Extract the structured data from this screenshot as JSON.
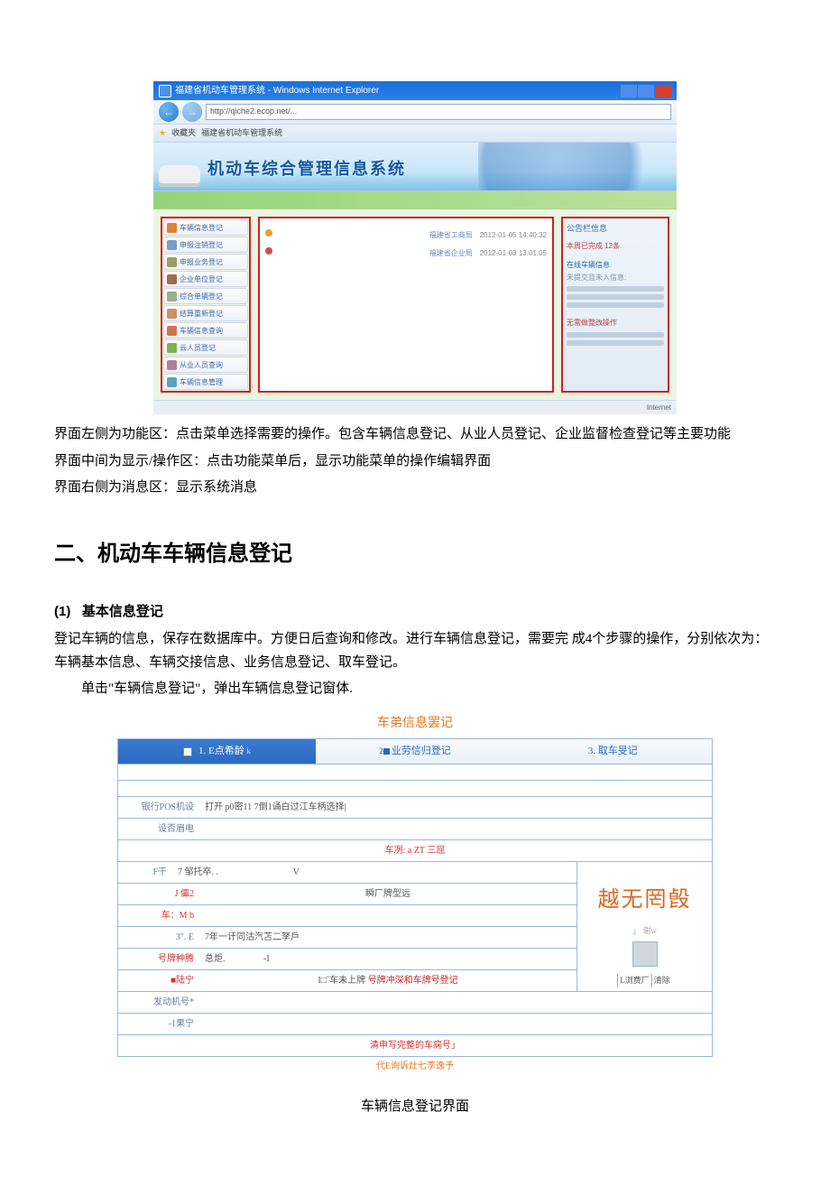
{
  "screenshot1": {
    "win_title": "福建省机动车管理系统 - Windows Internet Explorer",
    "url": "http://qiche2.ecop.net/...",
    "fav_label": "收藏夹",
    "site_label": "福建省机动车管理系统",
    "banner_title": "机动车综合管理信息系统",
    "sidebar_items": [
      "车辆信息登记",
      "申报注销登记",
      "申报业务登记",
      "企业单位登记",
      "综合单辆登记",
      "结算重新登记",
      "车辆信息查询",
      "云人员登记",
      "从业人员查询",
      "车辆信息管理"
    ],
    "center_items": [
      {
        "label_left": "",
        "label_mid": "福建省工商局",
        "date": "2012-01-05 14:40:32"
      },
      {
        "label_left": "",
        "label_mid": "福建省企业局",
        "date": "2012-01-03 13:01:05"
      }
    ],
    "right_title": "公告栏信息",
    "right_red1": "本周已完成 12条",
    "right_sub": "在线车辆信息",
    "right_sub2": "未提交且未入信息:",
    "right_red2": "无需做整改操作",
    "status": "Internet"
  },
  "para1": "界面左侧为功能区：点击菜单选择需要的操作。包含车辆信息登记、从业人员登记、企业监督检查登记等主要功能",
  "para2": "界面中间为显示/操作区：点击功能菜单后，显示功能菜单的操作编辑界面",
  "para3": "界面右侧为消息区：显示系统消息",
  "section2_title": "二、机动车车辆信息登记",
  "sub1_index": "(1)",
  "sub1_title": "基本信息登记",
  "sub1_p1": "登记车辆的信息，保存在数据库中。方便日后查询和修改。进行车辆信息登记，需要完 成4个步骤的操作，分别依次为：车辆基本信息、车辆交接信息、业务信息登记、取车登记。",
  "sub1_p2": "单击\"车辆信息登记\"，弹出车辆信息登记窗体.",
  "form": {
    "title": "车弟信息罢记",
    "tab1": "1. E点希龄",
    "tab1_suffix": "k",
    "tab2_prefix": "2",
    "tab2": "业劳信归登记",
    "tab3": "3. 取车旻记",
    "row_pos_label": "银行POS机设",
    "row_pos_val": "打开 p0密11 7倒1诵白过江车柄选择|",
    "row_meidi_label": "设否眉电",
    "midline": "车冽: a ZT 三屈",
    "row_ft_label": "F干",
    "row_ft_val": "7 邹托卒. .",
    "row_ft_right": "V",
    "row_1ei_label": "J 儡2",
    "row_1ei_val": "瞬厂牌型远",
    "row_car_label": "车：M b",
    "row_3e_label": "3\". E",
    "row_3e_val": "7年一讦同沽汽苫二孥戶",
    "row_bplabel": "号牌种腾",
    "row_bp_val": "总炬.",
    "row_bp_mid": "-I",
    "row_pn_label": "■陆宁",
    "row_pn_val": "I□˝车未上牌",
    "row_pn_link": "号牌冲深和车牌号登记",
    "row_fd_label": "发动机号*",
    "row_gn_label": "-1果宁",
    "bottom_msg": "清申写完整的车痫号」",
    "below_msg": "代E询诉灶七李逸予",
    "photo_text": "越无罔㲃",
    "photo_sub": "」  谢w",
    "btn_browse": "L浏费厂",
    "btn_clear": "清除"
  },
  "caption": "车辆信息登记界面"
}
